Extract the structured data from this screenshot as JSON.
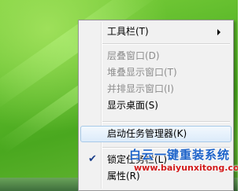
{
  "context_menu": {
    "items": [
      {
        "label": "工具栏(T)",
        "disabled": false,
        "has_submenu": true
      },
      {
        "label": "层叠窗口(D)",
        "disabled": true
      },
      {
        "label": "堆叠显示窗口(T)",
        "disabled": true
      },
      {
        "label": "并排显示窗口(I)",
        "disabled": true
      },
      {
        "label": "显示桌面(S)",
        "disabled": false
      },
      {
        "label": "启动任务管理器(K)",
        "disabled": false,
        "highlighted": true
      },
      {
        "label": "锁定任务栏(L)",
        "disabled": false,
        "checked": true
      },
      {
        "label": "属性(R)",
        "disabled": false
      }
    ]
  },
  "watermark": {
    "title": "白云一键重装系统",
    "url": "www.baiyunxitong.com"
  },
  "colors": {
    "menu_bg": "#f1f1f1",
    "hover_border": "#a8cae8",
    "watermark_blue": "#1c62c9",
    "watermark_red": "#d11a1a",
    "desktop_green": "#5cb92a"
  }
}
